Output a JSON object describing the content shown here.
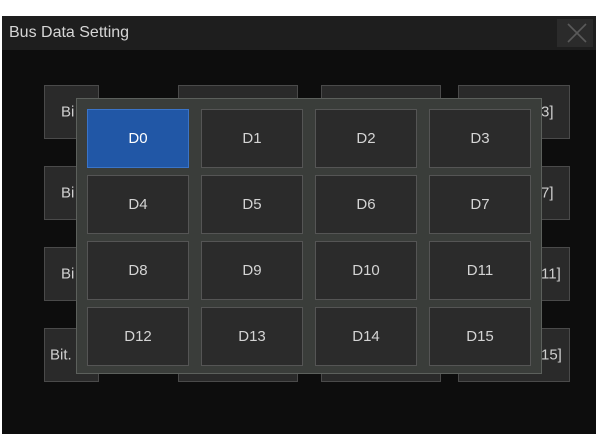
{
  "dialog": {
    "title": "Bus Data Setting",
    "close_icon": "close-icon"
  },
  "background_buttons": [
    {
      "left_text": "Bi",
      "right_text": "3]"
    },
    {
      "left_text": "Bi",
      "right_text": "7]"
    },
    {
      "left_text": "Bi",
      "right_text": "11]"
    },
    {
      "left_text": "Bit.",
      "right_text": "15]"
    }
  ],
  "channel_grid": {
    "items": [
      "D0",
      "D1",
      "D2",
      "D3",
      "D4",
      "D5",
      "D6",
      "D7",
      "D8",
      "D9",
      "D10",
      "D11",
      "D12",
      "D13",
      "D14",
      "D15"
    ],
    "selected": "D0"
  },
  "colors": {
    "selected": "#2157a6",
    "button": "#2b2b2b",
    "panel": "#3a3d3a"
  }
}
